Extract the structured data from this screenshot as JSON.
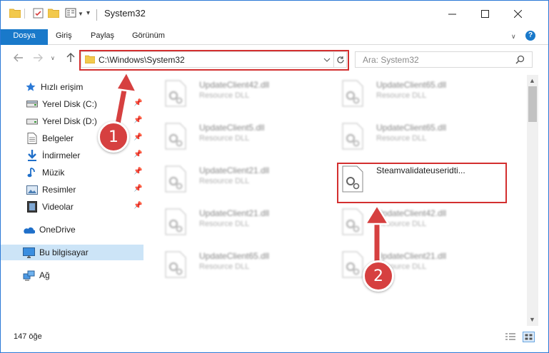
{
  "window": {
    "title": "System32"
  },
  "ribbon": {
    "tabs": [
      "Dosya",
      "Giriş",
      "Paylaş",
      "Görünüm"
    ]
  },
  "address": {
    "path": "C:\\Windows\\System32"
  },
  "search": {
    "placeholder": "Ara: System32"
  },
  "nav": {
    "items": [
      {
        "label": "Hızlı erişim",
        "icon": "star-icon",
        "pinned": false
      },
      {
        "label": "Yerel Disk (C:)",
        "icon": "drive-icon",
        "pinned": true
      },
      {
        "label": "Yerel Disk (D:)",
        "icon": "drive-icon",
        "pinned": true
      },
      {
        "label": "Belgeler",
        "icon": "documents-icon",
        "pinned": true
      },
      {
        "label": "İndirmeler",
        "icon": "download-icon",
        "pinned": true
      },
      {
        "label": "Müzik",
        "icon": "music-icon",
        "pinned": true
      },
      {
        "label": "Resimler",
        "icon": "pictures-icon",
        "pinned": true
      },
      {
        "label": "Videolar",
        "icon": "video-icon",
        "pinned": true
      },
      {
        "label": "OneDrive",
        "icon": "onedrive-icon",
        "pinned": false
      },
      {
        "label": "Bu bilgisayar",
        "icon": "computer-icon",
        "pinned": false,
        "selected": true
      },
      {
        "label": "Ağ",
        "icon": "network-icon",
        "pinned": false
      }
    ]
  },
  "files": {
    "col1": [
      {
        "name": "UpdateClient42.dll",
        "type": "Resource DLL"
      },
      {
        "name": "UpdateClient5.dll",
        "type": "Resource DLL"
      },
      {
        "name": "UpdateClient21.dll",
        "type": "Resource DLL"
      },
      {
        "name": "UpdateClient21.dll",
        "type": "Resource DLL"
      },
      {
        "name": "UpdateClient65.dll",
        "type": "Resource DLL"
      }
    ],
    "col2": [
      {
        "name": "UpdateClient65.dll",
        "type": "Resource DLL"
      },
      {
        "name": "UpdateClient65.dll",
        "type": "Resource DLL"
      },
      {
        "name": "Steamvalidateuseridti...",
        "type": "",
        "highlighted": true
      },
      {
        "name": "UpdateClient42.dll",
        "type": "Resource DLL"
      },
      {
        "name": "UpdateClient21.dll",
        "type": "Resource DLL"
      }
    ]
  },
  "status": {
    "item_count": "147 öğe"
  },
  "callouts": {
    "one": "1",
    "two": "2"
  },
  "colors": {
    "accent": "#1979ca",
    "highlight": "#d32f2f",
    "selected_bg": "#cce4f7"
  }
}
